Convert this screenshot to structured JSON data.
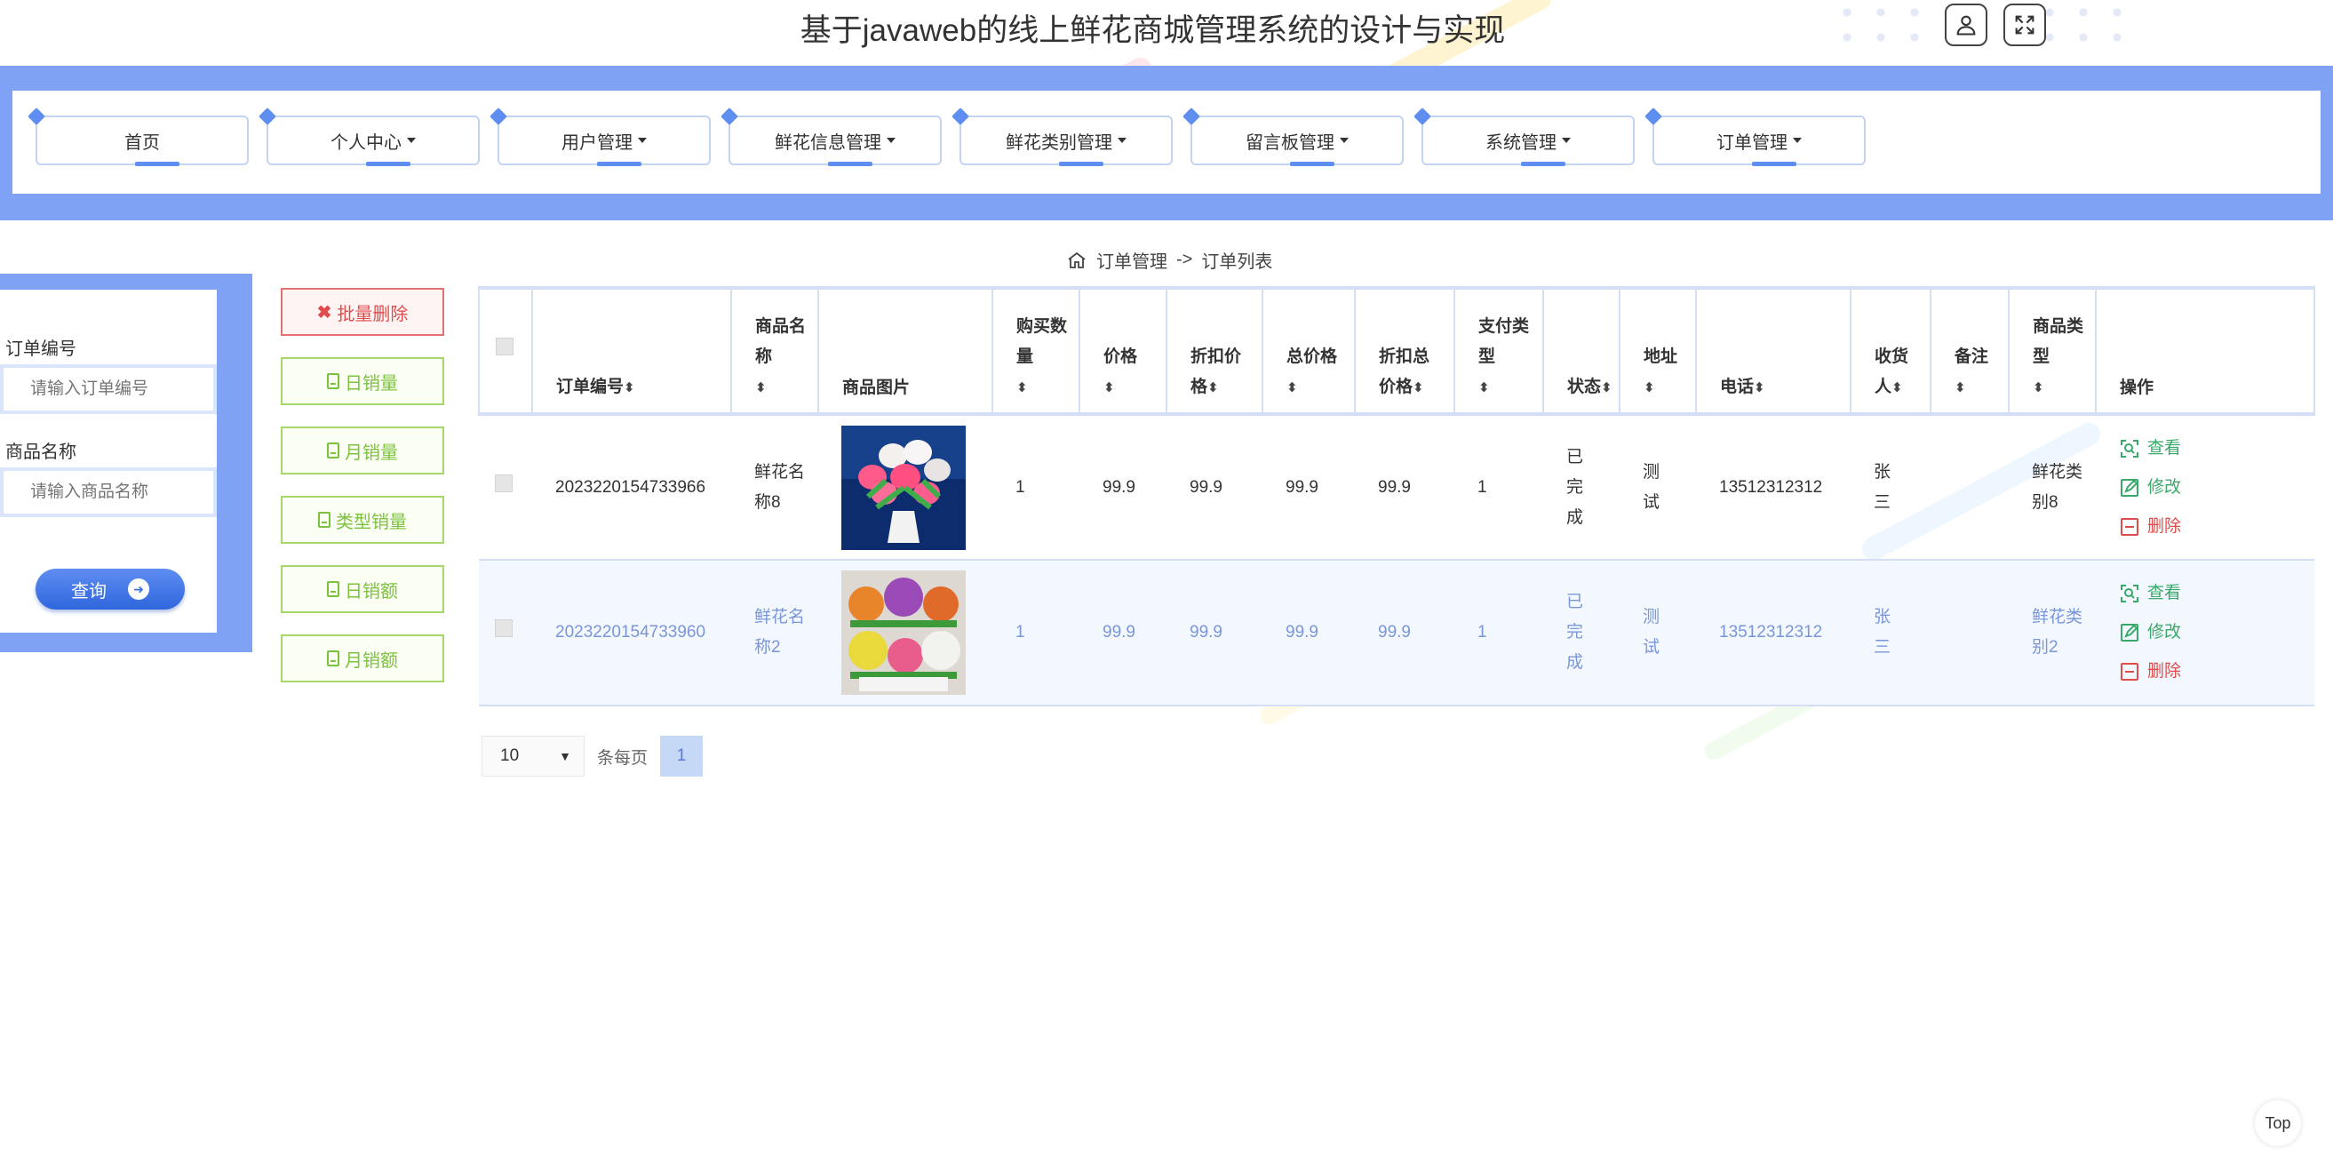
{
  "header": {
    "title": "基于javaweb的线上鲜花商城管理系统的设计与实现"
  },
  "nav": {
    "items": [
      {
        "label": "首页",
        "dropdown": false
      },
      {
        "label": "个人中心",
        "dropdown": true
      },
      {
        "label": "用户管理",
        "dropdown": true
      },
      {
        "label": "鲜花信息管理",
        "dropdown": true
      },
      {
        "label": "鲜花类别管理",
        "dropdown": true
      },
      {
        "label": "留言板管理",
        "dropdown": true
      },
      {
        "label": "系统管理",
        "dropdown": true
      },
      {
        "label": "订单管理",
        "dropdown": true
      }
    ]
  },
  "breadcrumb": {
    "section": "订单管理",
    "separator": "->",
    "page": "订单列表"
  },
  "search": {
    "order_no_label": "订单编号",
    "order_no_placeholder": "请输入订单编号",
    "product_name_label": "商品名称",
    "product_name_placeholder": "请输入商品名称",
    "query_label": "查询"
  },
  "side_buttons": {
    "batch_delete": "批量删除",
    "daily_sales_qty": "日销量",
    "monthly_sales_qty": "月销量",
    "type_sales_qty": "类型销量",
    "daily_sales_amount": "日销额",
    "monthly_sales_amount": "月销额"
  },
  "table": {
    "headers": {
      "order_no": "订单编号",
      "product_name": "商品名称",
      "product_image": "商品图片",
      "quantity": "购买数量",
      "price": "价格",
      "discount_price": "折扣价格",
      "total": "总价格",
      "discount_total": "折扣总价格",
      "pay_type": "支付类型",
      "status": "状态",
      "address": "地址",
      "phone": "电话",
      "receiver": "收货人",
      "remark": "备注",
      "product_type": "商品类型",
      "actions": "操作"
    },
    "rows": [
      {
        "order_no": "2023220154733966",
        "product_name": "鲜花名称8",
        "quantity": "1",
        "price": "99.9",
        "discount_price": "99.9",
        "total": "99.9",
        "discount_total": "99.9",
        "pay_type": "1",
        "status": "已完成",
        "address": "测试",
        "phone": "13512312312",
        "receiver": "张三",
        "remark": "",
        "product_type": "鲜花类别8"
      },
      {
        "order_no": "2023220154733960",
        "product_name": "鲜花名称2",
        "quantity": "1",
        "price": "99.9",
        "discount_price": "99.9",
        "total": "99.9",
        "discount_total": "99.9",
        "pay_type": "1",
        "status": "已完成",
        "address": "测试",
        "phone": "13512312312",
        "receiver": "张三",
        "remark": "",
        "product_type": "鲜花类别2"
      }
    ],
    "actions": {
      "view": "查看",
      "edit": "修改",
      "delete": "删除"
    }
  },
  "pagination": {
    "page_size": "10",
    "per_page_label": "条每页",
    "current_page": "1"
  },
  "top_button": "Top",
  "colors": {
    "accent_blue": "#7fa2f5",
    "button_green": "#7cc23d",
    "danger_red": "#e04b4b",
    "action_green": "#3aa86b"
  }
}
